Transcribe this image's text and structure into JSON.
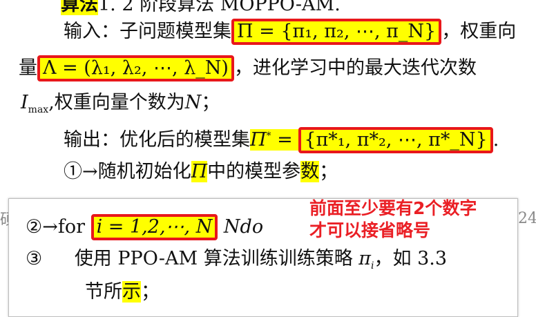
{
  "header_fragment": {
    "label": "算法",
    "rest": "1. 2 阶段算法 MOPPO-AM."
  },
  "line_input": {
    "prefix": "输入：子问题模型集",
    "pi_set": "Π = {π₁, π₂, ⋯, π_N}",
    "suffix": "，权重向"
  },
  "line_weights": {
    "char": "量",
    "lambda_vec": "Λ = (λ₁, λ₂, ⋯, λ_N)",
    "suffix": "，进化学习中的最大迭代次数"
  },
  "line_imax": {
    "text": ",权重向量个数为",
    "N": "N",
    "end": "；"
  },
  "line_output": {
    "prefix": "输出：优化后的模型集",
    "pi_star_set": "{π*₁, π*₂, ⋯, π*_N}",
    "end": "."
  },
  "step1": {
    "text": "①→随机初始化",
    "Pi": "Π",
    "mid": "中的模型参",
    "hl_char": "数",
    "end": "；"
  },
  "panel": {
    "step2": {
      "prefix": "②→for",
      "loop": "i = 1,2,⋯, N",
      "suffix": "Ndo"
    },
    "step3": {
      "num": "③",
      "text": "使用 PPO-AM 算法训练训练策略",
      "pi_i": "π",
      "sub": "i",
      "tail": "，如 3.3"
    },
    "step3b": {
      "prefix": "节所",
      "hl": "示",
      "end": "；"
    }
  },
  "annotation": {
    "line1": "前面至少要有2个数字",
    "line2": "才可以接省略号"
  },
  "edge_text": {
    "right": "24",
    "left": "硕"
  },
  "colors": {
    "highlight": "#ffff00",
    "box_border": "#e8171b",
    "annotation": "#ea1f25"
  }
}
